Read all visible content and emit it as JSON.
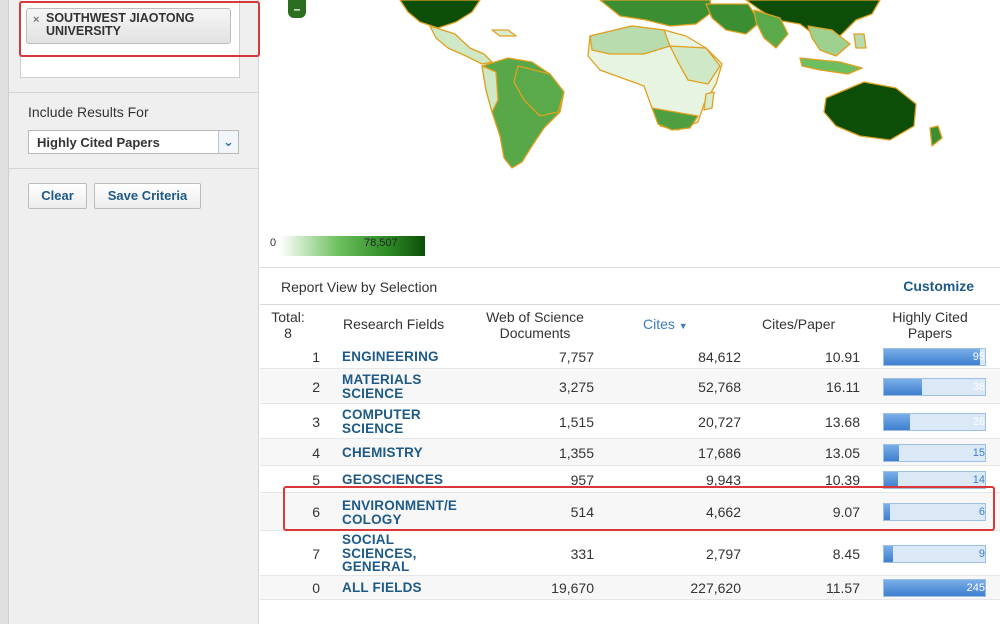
{
  "filter": {
    "chip_label": "SOUTHWEST JIAOTONG UNIVERSITY",
    "remove_glyph": "×"
  },
  "sidebar": {
    "include_label": "Include Results For",
    "select_value": "Highly Cited Papers",
    "clear_label": "Clear",
    "save_label": "Save Criteria"
  },
  "map": {
    "legend_min": "0",
    "legend_max": "78,507",
    "zoom_out_glyph": "–"
  },
  "report": {
    "title": "Report View by Selection",
    "customize_label": "Customize"
  },
  "table": {
    "headers": {
      "total": "Total: 8",
      "fields": "Research Fields",
      "wos": "Web of Science Documents",
      "cites": "Cites",
      "cpp": "Cites/Paper",
      "hcp": "Highly Cited Papers"
    },
    "rows": [
      {
        "idx": "1",
        "field": "ENGINEERING",
        "wos": "7,757",
        "cites": "84,612",
        "cpp": "10.91",
        "hcp": 95,
        "hcp_label": "95"
      },
      {
        "idx": "2",
        "field": "MATERIALS SCIENCE",
        "wos": "3,275",
        "cites": "52,768",
        "cpp": "16.11",
        "hcp": 38,
        "hcp_label": "38"
      },
      {
        "idx": "3",
        "field": "COMPUTER SCIENCE",
        "wos": "1,515",
        "cites": "20,727",
        "cpp": "13.68",
        "hcp": 26,
        "hcp_label": "26"
      },
      {
        "idx": "4",
        "field": "CHEMISTRY",
        "wos": "1,355",
        "cites": "17,686",
        "cpp": "13.05",
        "hcp": 15,
        "hcp_label": "15"
      },
      {
        "idx": "5",
        "field": "GEOSCIENCES",
        "wos": "957",
        "cites": "9,943",
        "cpp": "10.39",
        "hcp": 14,
        "hcp_label": "14"
      },
      {
        "idx": "6",
        "field": "ENVIRONMENT/ECOLOGY",
        "wos": "514",
        "cites": "4,662",
        "cpp": "9.07",
        "hcp": 6,
        "hcp_label": "6"
      },
      {
        "idx": "7",
        "field": "SOCIAL SCIENCES, GENERAL",
        "wos": "331",
        "cites": "2,797",
        "cpp": "8.45",
        "hcp": 9,
        "hcp_label": "9"
      },
      {
        "idx": "0",
        "field": "ALL FIELDS",
        "wos": "19,670",
        "cites": "227,620",
        "cpp": "11.57",
        "hcp": 245,
        "hcp_label": "245"
      }
    ]
  },
  "colors": {
    "link": "#1d5a87",
    "accent": "#3b7bbf",
    "highlight": "#d9373a",
    "map_dark": "#0c4e08",
    "map_border": "#e0a020"
  }
}
